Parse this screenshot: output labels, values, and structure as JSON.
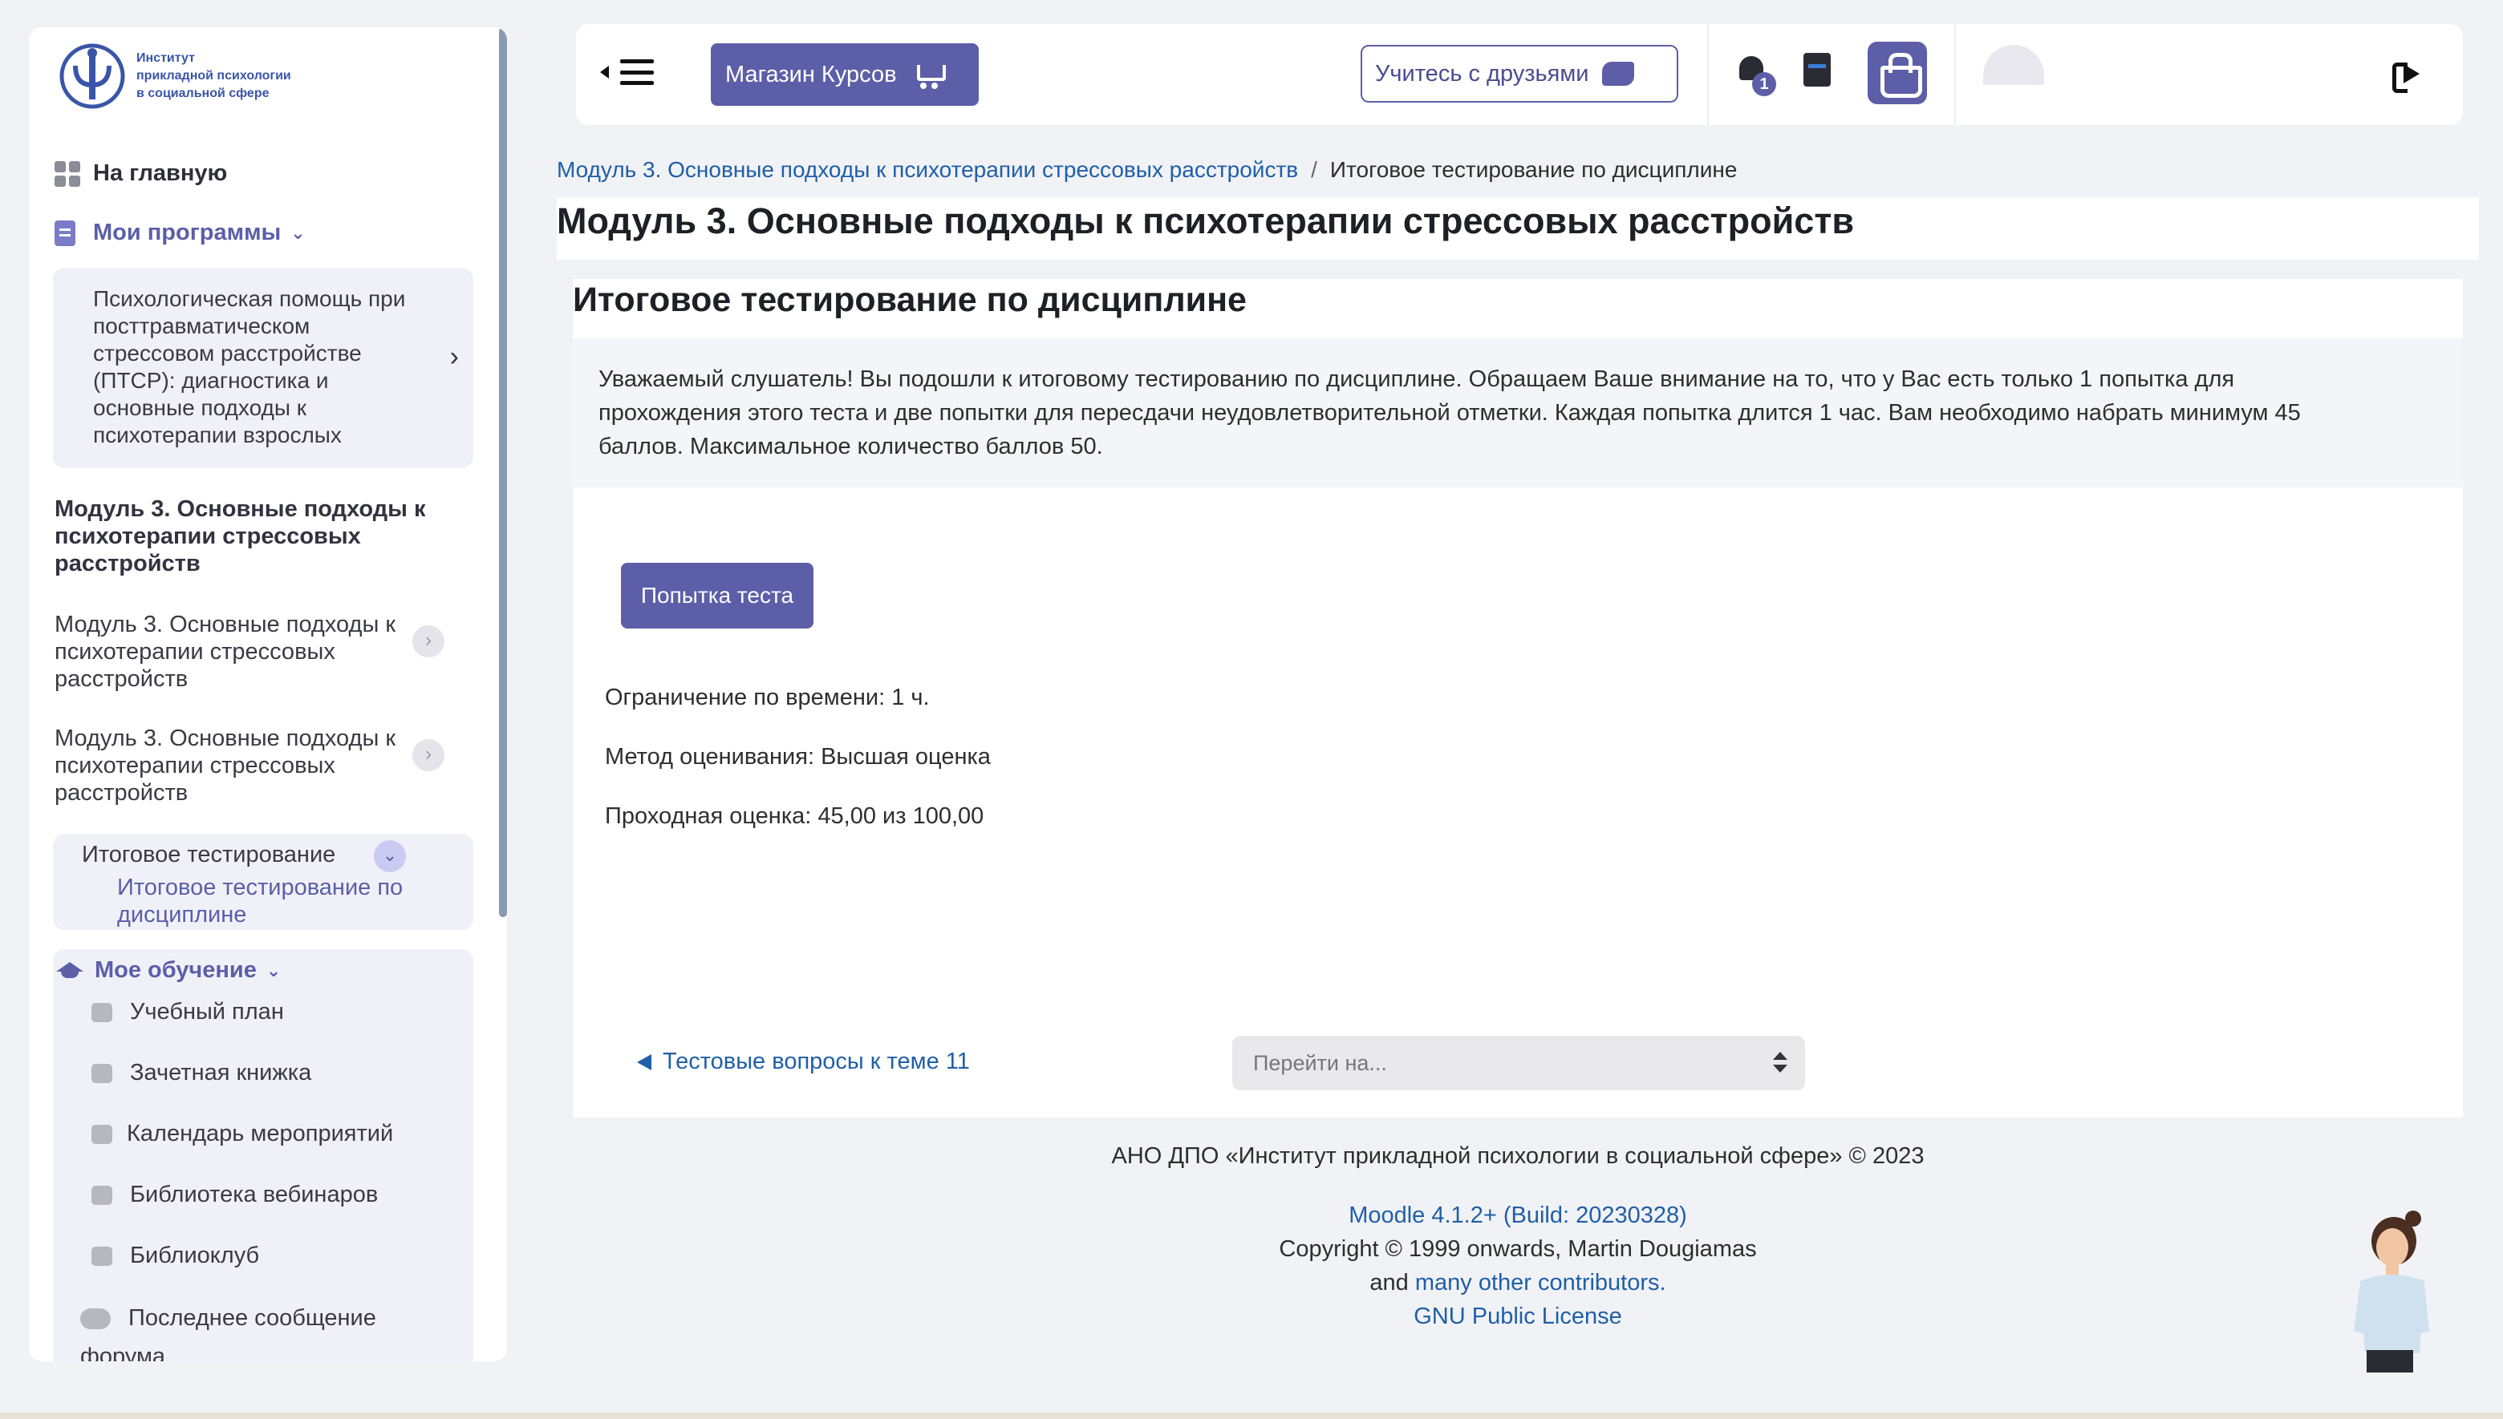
{
  "sidebar": {
    "logo_text": [
      "Институт",
      "прикладной психологии",
      "в социальной сфере"
    ],
    "home": "На главную",
    "programs": "Мои программы",
    "program_title": "Психологическая помощь при посттравматическом стрессовом расстройстве (ПТСР): диагностика и основные подходы к психотерапии взрослых",
    "module_heading": "Модуль 3. Основные подходы к психотерапии стрессовых расстройств",
    "module_items": [
      "Модуль 3. Основные подходы к психотерапии стрессовых расстройств",
      "Модуль 3. Основные подходы к психотерапии стрессовых расстройств"
    ],
    "final_section": "Итоговое тестирование",
    "final_item": "Итоговое тестирование по дисциплине",
    "learning": "Мое обучение",
    "learning_items": [
      "Учебный план",
      "Зачетная книжка",
      "Календарь мероприятий",
      "Библиотека вебинаров",
      "Библиоклуб"
    ],
    "learning_last": "Последнее сообщение форума"
  },
  "topbar": {
    "shop_label": "Магазин Курсов",
    "friends_label": "Учитесь с друзьями",
    "notification_count": "1"
  },
  "breadcrumb": {
    "module": "Модуль 3. Основные подходы к психотерапии стрессовых расстройств",
    "separator": "/",
    "current": "Итоговое тестирование по дисциплине"
  },
  "page_title": "Модуль 3. Основные подходы к психотерапии стрессовых расстройств",
  "activity": {
    "title": "Итоговое тестирование по дисциплине",
    "intro": "Уважаемый слушатель! Вы подошли к итоговому тестированию по дисциплине. Обращаем Ваше внимание на то, что у Вас есть только 1 попытка для прохождения этого теста и две попытки для пересдачи неудовлетворительной отметки. Каждая попытка длится 1 час. Вам необходимо набрать минимум 45 баллов. Максимальное количество баллов 50.",
    "attempt_button": "Попытка теста",
    "time_limit": "Ограничение по времени: 1 ч.",
    "grading_method": "Метод оценивания: Высшая оценка",
    "pass_grade": "Проходная оценка: 45,00 из 100,00",
    "prev_link": "Тестовые вопросы к теме 11",
    "jump_placeholder": "Перейти на..."
  },
  "footer": {
    "org": "АНО ДПО «Институт прикладной психологии в социальной сфере» © 2023",
    "moodle": "Moodle 4.1.2+ (Build: 20230328)",
    "copyright": "Copyright © 1999 onwards, Martin Dougiamas",
    "and": "and",
    "contributors": "many other contributors.",
    "license": "GNU Public License"
  },
  "colors": {
    "accent": "#5c5ea8",
    "link": "#1f5fa8",
    "background": "#f1f2f6"
  }
}
